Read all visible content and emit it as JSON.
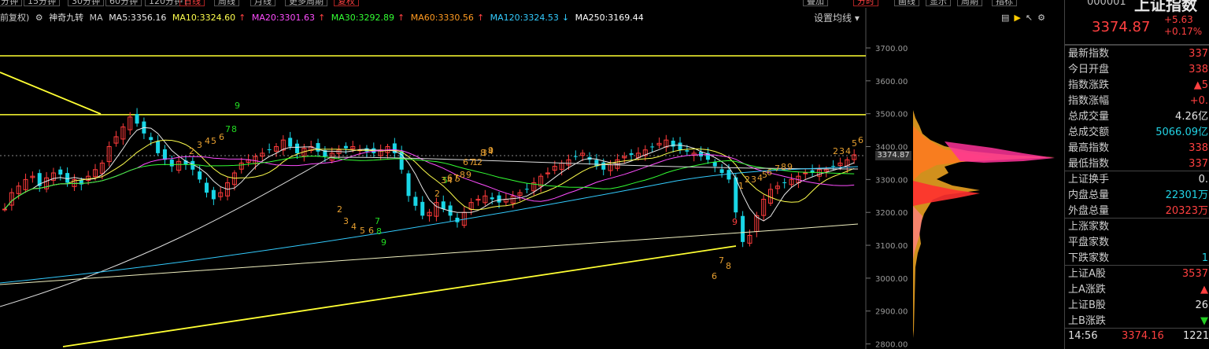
{
  "tabs": [
    "分钟",
    "15分钟",
    "30分钟",
    "60分钟",
    "120分钟",
    "日线",
    "周线",
    "月线",
    "更多周期",
    "复权",
    "叠加",
    "分时",
    "画线",
    "显示",
    "周期",
    "指标"
  ],
  "ma_header": {
    "fq": "前复权)",
    "indicator": "神奇九转",
    "ma_label": "MA",
    "ma5": "MA5:3356.16",
    "ma10": "MA10:3324.60",
    "ma20": "MA20:3301.63",
    "ma30": "MA30:3292.89",
    "ma60": "MA60:3330.56",
    "ma120": "MA120:3324.53",
    "ma250": "MA250:3169.44",
    "settings": "设置均线"
  },
  "colors": {
    "ma5": "#e8e8e8",
    "ma10": "#ffff4d",
    "ma20": "#ff4dff",
    "ma30": "#33ff33",
    "ma60": "#ff9a20",
    "ma120": "#33ccff",
    "ma250": "#ffffff",
    "up": "#ff3b3b",
    "down": "#19d6e6",
    "trend": "#ffff33"
  },
  "chart_data": {
    "type": "candlestick",
    "y_ticks": [
      "3700.00",
      "3600.00",
      "3500.00",
      "3400.00",
      "3300.00",
      "3200.00",
      "3100.00",
      "3000.00",
      "2900.00",
      "2800.00"
    ],
    "current_price_label": "3374.87",
    "nine_turn_labels": [
      "9",
      "7",
      "8",
      "2",
      "3",
      "4",
      "5",
      "6",
      "2",
      "3",
      "4",
      "5",
      "6",
      "7",
      "8",
      "9",
      "5",
      "6",
      "7",
      "8",
      "9",
      "1",
      "2",
      "3",
      "4",
      "2",
      "3",
      "4",
      "5",
      "6",
      "7",
      "8",
      "9",
      "6",
      "7",
      "8",
      "9",
      "1",
      "2",
      "3",
      "4",
      "5",
      "6",
      "7",
      "8",
      "9",
      "2",
      "3",
      "4",
      "5",
      "6"
    ]
  },
  "quote": {
    "code": "000001",
    "name": "上证指数",
    "price": "3374.87",
    "change": "+5.63",
    "change_pct": "+0.17%",
    "rows": [
      {
        "label": "最新指数",
        "value": "337",
        "cls": "red"
      },
      {
        "label": "今日开盘",
        "value": "338",
        "cls": "red"
      },
      {
        "label": "指数涨跌",
        "value": "▲5",
        "cls": "red"
      },
      {
        "label": "指数涨幅",
        "value": "+0.",
        "cls": "red"
      },
      {
        "label": "总成交量",
        "value": "4.26亿",
        "cls": "white"
      },
      {
        "label": "总成交额",
        "value": "5066.09亿",
        "cls": "cyan"
      },
      {
        "label": "最高指数",
        "value": "338",
        "cls": "red"
      },
      {
        "label": "最低指数",
        "value": "337",
        "cls": "red"
      },
      {
        "label": "上证换手",
        "value": "0.",
        "cls": "white"
      },
      {
        "label": "内盘总量",
        "value": "22301万",
        "cls": "cyan"
      },
      {
        "label": "外盘总量",
        "value": "20323万",
        "cls": "red"
      },
      {
        "label": "上涨家数",
        "value": "",
        "cls": "red"
      },
      {
        "label": "平盘家数",
        "value": "",
        "cls": "white"
      },
      {
        "label": "下跌家数",
        "value": "1",
        "cls": "cyan"
      },
      {
        "label": "上证A股",
        "value": "3537",
        "cls": "red"
      },
      {
        "label": "上A涨跌",
        "value": "▲",
        "cls": "red"
      },
      {
        "label": "上证B股",
        "value": "26",
        "cls": "white"
      },
      {
        "label": "上B涨跌",
        "value": "▼",
        "cls": "green"
      }
    ],
    "time": "14:56",
    "time_price": "3374.16",
    "time_vol": "1221"
  }
}
